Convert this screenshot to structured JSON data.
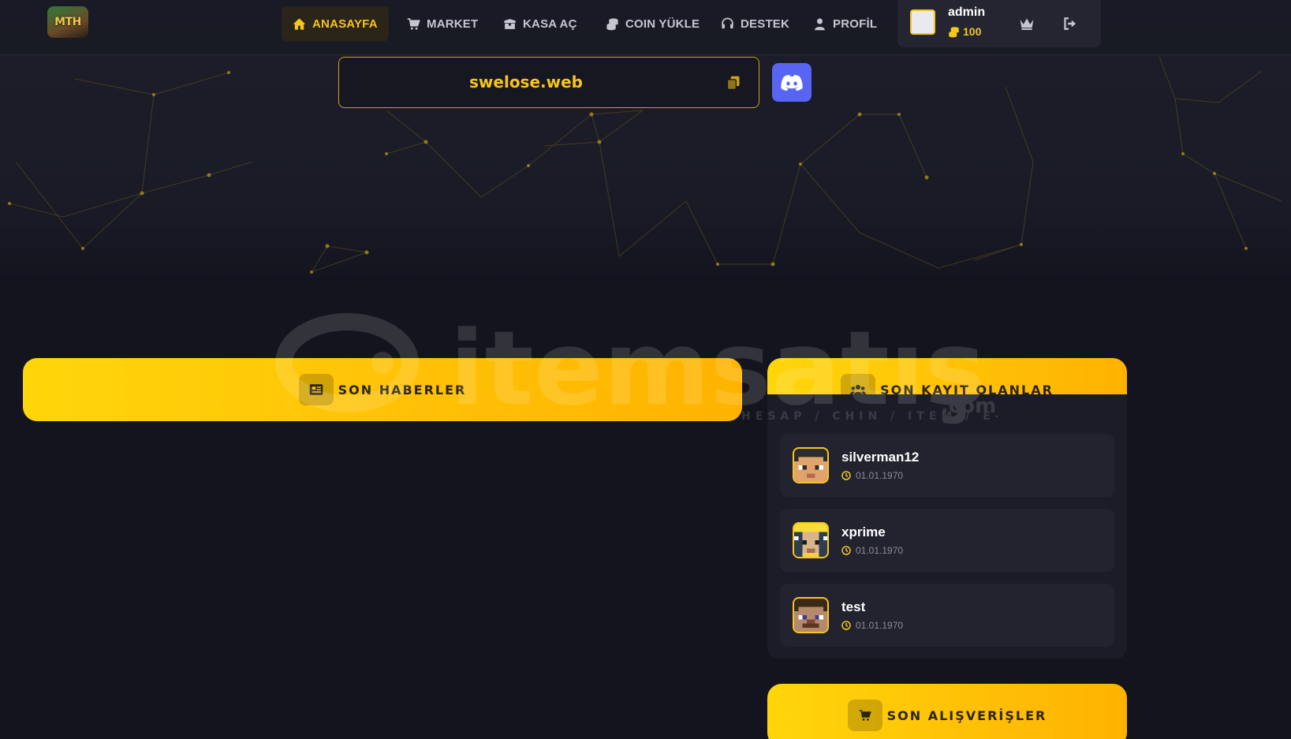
{
  "nav": {
    "logo_text": "MTH",
    "items": [
      {
        "label": "ANASAYFA",
        "icon": "home-icon",
        "active": true
      },
      {
        "label": "MARKET",
        "icon": "cart-icon",
        "active": false
      },
      {
        "label": "KASA AÇ",
        "icon": "box-icon",
        "active": false
      },
      {
        "label": "COIN YÜKLE",
        "icon": "coins-icon",
        "active": false
      },
      {
        "label": "DESTEK",
        "icon": "headset-icon",
        "active": false
      },
      {
        "label": "PROFİL",
        "icon": "user-icon",
        "active": false
      }
    ]
  },
  "user": {
    "name": "admin",
    "coins": "100",
    "icons": [
      "crown-icon",
      "logout-icon"
    ]
  },
  "server": {
    "ip": "swelose.web",
    "copy_icon": "copy-icon",
    "discord_icon": "discord-icon"
  },
  "watermark": {
    "text": "itemsatış",
    "suffix": ".com",
    "tagline": "HESAP / CHIN / ITEM / E-PIN"
  },
  "sections": {
    "news_title": "SON HABERLER",
    "registrations_title": "SON KAYIT OLANLAR",
    "purchases_title": "SON ALIŞVERİŞLER"
  },
  "registrations": [
    {
      "name": "silverman12",
      "date": "01.01.1970"
    },
    {
      "name": "xprime",
      "date": "01.01.1970"
    },
    {
      "name": "test",
      "date": "01.01.1970"
    }
  ],
  "colors": {
    "accent": "#f7c51e",
    "background": "#14141f",
    "discord": "#5865f2"
  }
}
